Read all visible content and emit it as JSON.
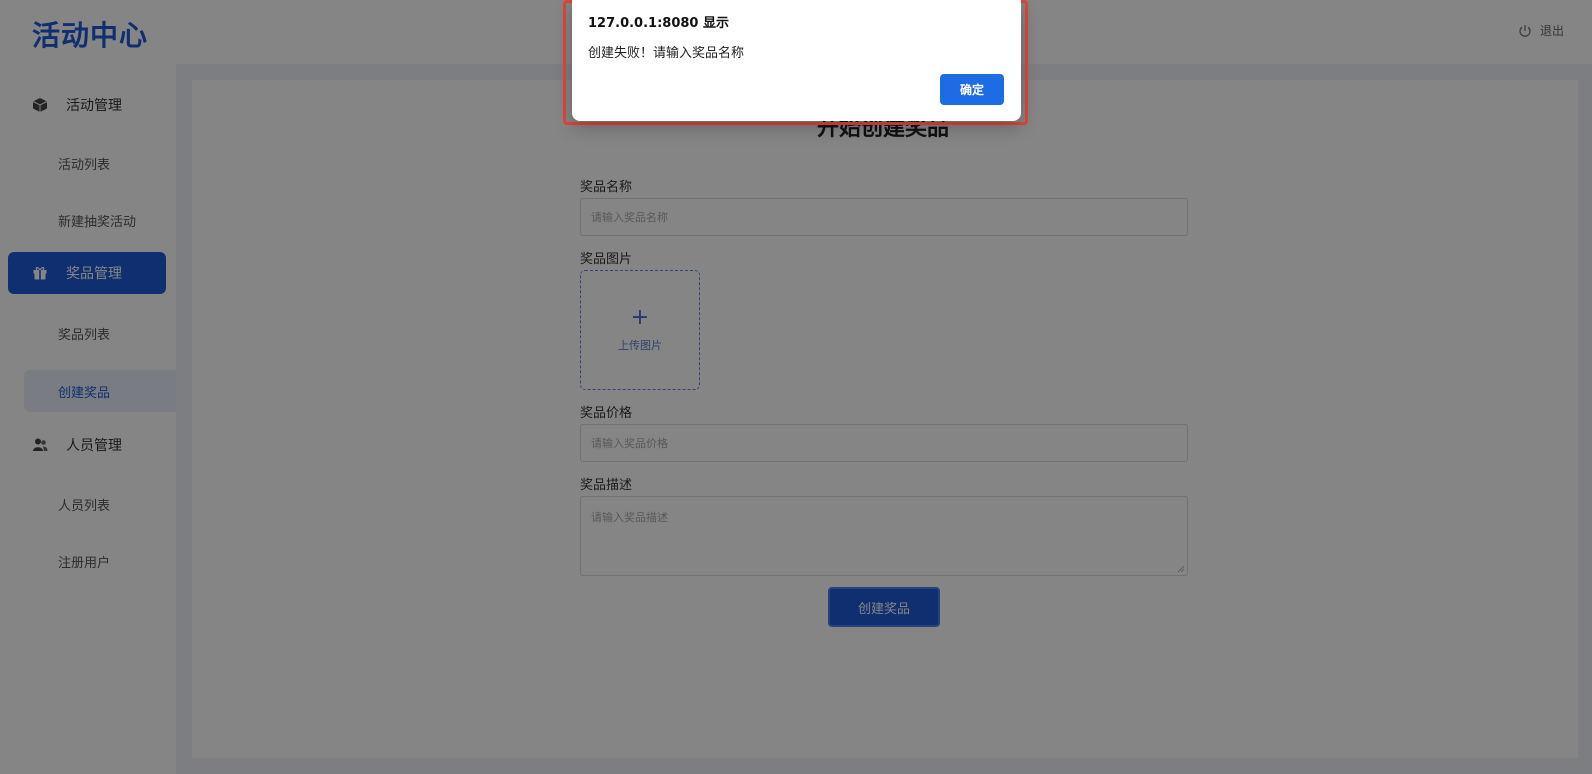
{
  "app": {
    "logo": "活动中心",
    "logout_label": "退出"
  },
  "sidebar": {
    "groups": [
      {
        "label": "活动管理",
        "icon": "box-icon",
        "items": [
          "活动列表",
          "新建抽奖活动"
        ]
      },
      {
        "label": "奖品管理",
        "icon": "gift-icon",
        "items": [
          "奖品列表",
          "创建奖品"
        ]
      },
      {
        "label": "人员管理",
        "icon": "users-icon",
        "items": [
          "人员列表",
          "注册用户"
        ]
      }
    ],
    "active_group": "奖品管理",
    "current_item": "创建奖品"
  },
  "form": {
    "title": "开始创建奖品",
    "name_label": "奖品名称",
    "name_placeholder": "请输入奖品名称",
    "image_label": "奖品图片",
    "upload_text": "上传图片",
    "price_label": "奖品价格",
    "price_placeholder": "请输入奖品价格",
    "desc_label": "奖品描述",
    "desc_placeholder": "请输入奖品描述",
    "submit_label": "创建奖品"
  },
  "dialog": {
    "title": "127.0.0.1:8080 显示",
    "message": "创建失败！请输入奖品名称",
    "ok_label": "确定"
  },
  "colors": {
    "primary": "#1e5bd8",
    "highlight": "#e0463a",
    "content_bg": "#eef2f9"
  }
}
